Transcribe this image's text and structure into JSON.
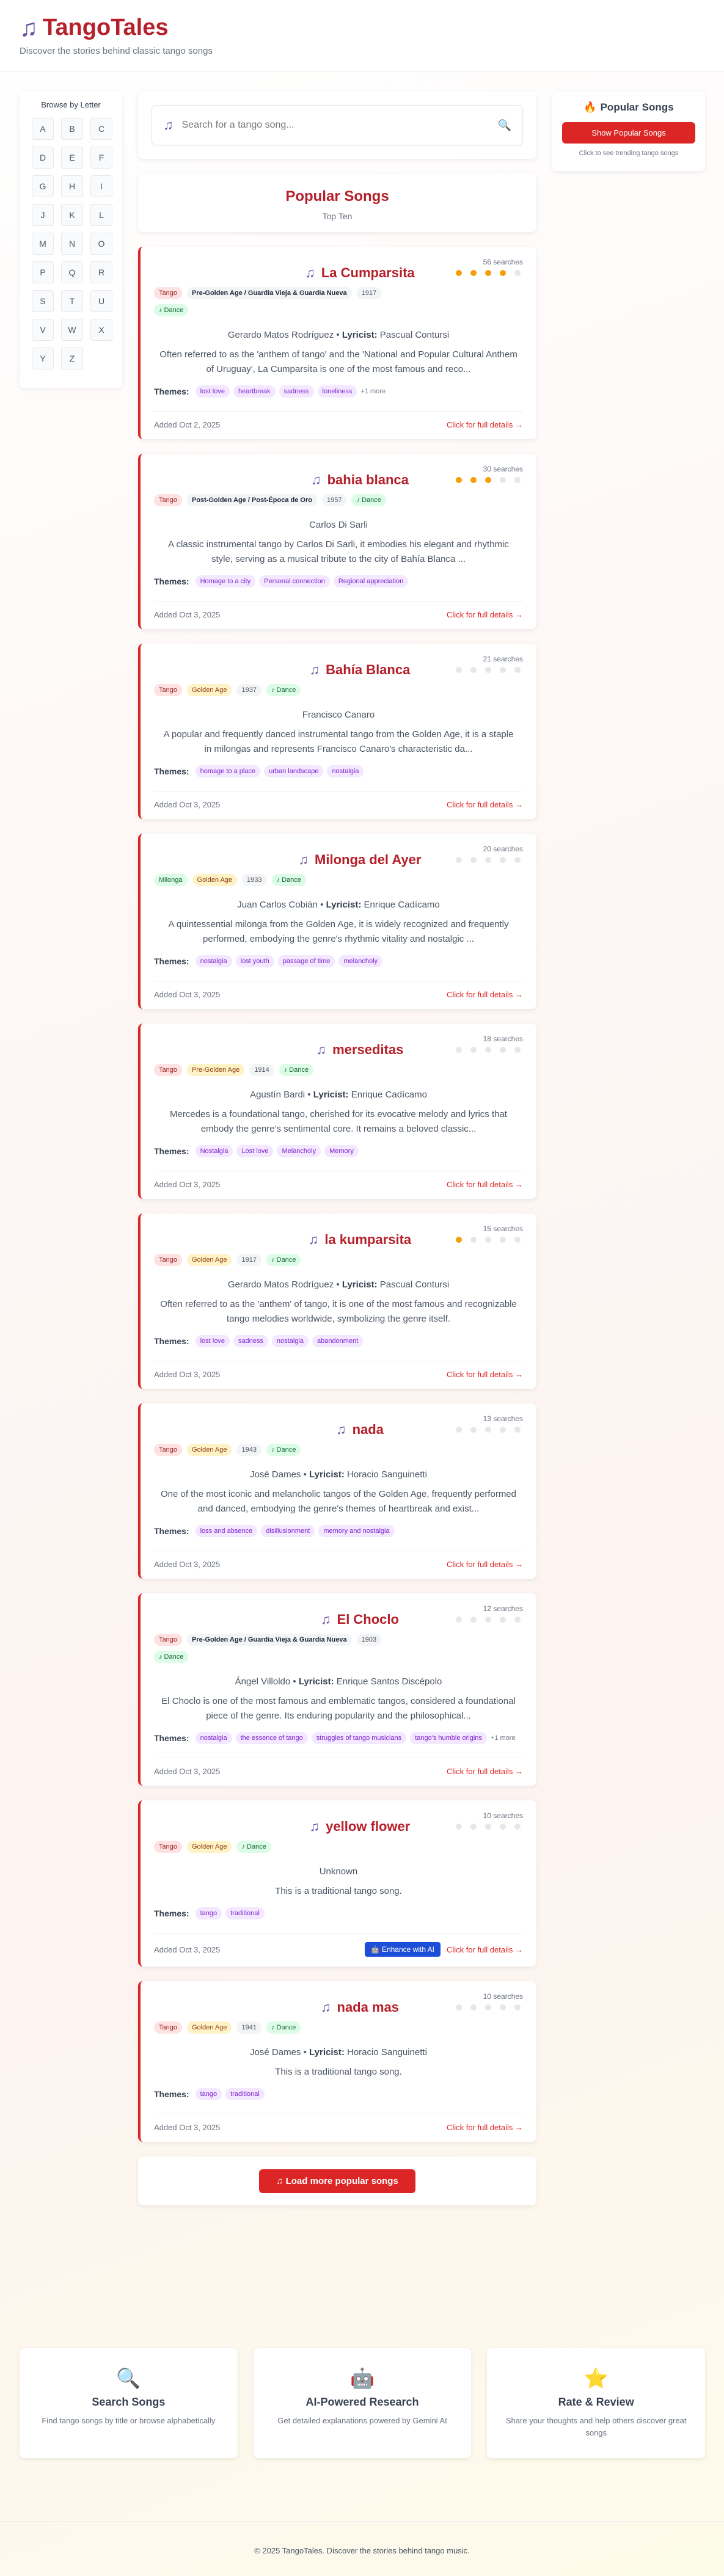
{
  "header": {
    "title": "TangoTales",
    "tagline": "Discover the stories behind classic tango songs"
  },
  "letters": {
    "title": "Browse by Letter",
    "items": [
      "A",
      "B",
      "C",
      "D",
      "E",
      "F",
      "G",
      "H",
      "I",
      "J",
      "K",
      "L",
      "M",
      "N",
      "O",
      "P",
      "Q",
      "R",
      "S",
      "T",
      "U",
      "V",
      "W",
      "X",
      "Y",
      "Z"
    ]
  },
  "search": {
    "placeholder": "Search for a tango song..."
  },
  "popular_panel": {
    "title": "Popular Songs",
    "button": "Show Popular Songs",
    "hint": "Click to see trending tango songs"
  },
  "popular_heading": {
    "title": "Popular Songs",
    "subtitle": "Top Ten"
  },
  "labels": {
    "themes": "Themes:",
    "lyricist": "Lyricist:",
    "details": "Click for full details →",
    "enhance": "Enhance with AI"
  },
  "songs": [
    {
      "title": "La Cumparsita",
      "searches": "56 searches",
      "rating": 4,
      "badges": [
        {
          "text": "Tango",
          "kind": "genre"
        },
        {
          "text": "Pre-Golden Age / Guardia Vieja & Guardia Nueva",
          "kind": "era-long"
        },
        {
          "text": "1917",
          "kind": "year"
        },
        {
          "text": "♪ Dance",
          "kind": "dance"
        }
      ],
      "composer": "Gerardo Matos Rodríguez",
      "lyricist": "Pascual Contursi",
      "description": "Often referred to as the 'anthem of tango' and the 'National and Popular Cultural Anthem of Uruguay', La Cumparsita is one of the most famous and reco...",
      "themes": [
        "lost love",
        "heartbreak",
        "sadness",
        "loneliness"
      ],
      "more": "+1 more",
      "added": "Added Oct 2, 2025"
    },
    {
      "title": "bahia blanca",
      "searches": "30 searches",
      "rating": 3,
      "badges": [
        {
          "text": "Tango",
          "kind": "genre"
        },
        {
          "text": "Post-Golden Age / Post-Época de Oro",
          "kind": "era-long"
        },
        {
          "text": "1957",
          "kind": "year"
        },
        {
          "text": "♪ Dance",
          "kind": "dance"
        }
      ],
      "composer": "Carlos Di Sarli",
      "lyricist": "",
      "description": "A classic instrumental tango by Carlos Di Sarli, it embodies his elegant and rhythmic style, serving as a musical tribute to the city of Bahía Blanca ...",
      "themes": [
        "Homage to a city",
        "Personal connection",
        "Regional appreciation"
      ],
      "more": "",
      "added": "Added Oct 3, 2025"
    },
    {
      "title": "Bahía Blanca",
      "searches": "21 searches",
      "rating": 0,
      "badges": [
        {
          "text": "Tango",
          "kind": "genre"
        },
        {
          "text": "Golden Age",
          "kind": "era"
        },
        {
          "text": "1937",
          "kind": "year"
        },
        {
          "text": "♪ Dance",
          "kind": "dance"
        }
      ],
      "composer": "Francisco Canaro",
      "lyricist": "",
      "description": "A popular and frequently danced instrumental tango from the Golden Age, it is a staple in milongas and represents Francisco Canaro's characteristic da...",
      "themes": [
        "homage to a place",
        "urban landscape",
        "nostalgia"
      ],
      "more": "",
      "added": "Added Oct 3, 2025"
    },
    {
      "title": "Milonga del Ayer",
      "searches": "20 searches",
      "rating": 0,
      "badges": [
        {
          "text": "Milonga",
          "kind": "milonga"
        },
        {
          "text": "Golden Age",
          "kind": "era"
        },
        {
          "text": "1933",
          "kind": "year"
        },
        {
          "text": "♪ Dance",
          "kind": "dance"
        }
      ],
      "composer": "Juan Carlos Cobián",
      "lyricist": "Enrique Cadícamo",
      "description": "A quintessential milonga from the Golden Age, it is widely recognized and frequently performed, embodying the genre's rhythmic vitality and nostalgic ...",
      "themes": [
        "nostalgia",
        "lost youth",
        "passage of time",
        "melancholy"
      ],
      "more": "",
      "added": "Added Oct 3, 2025"
    },
    {
      "title": "merseditas",
      "searches": "18 searches",
      "rating": 0,
      "badges": [
        {
          "text": "Tango",
          "kind": "genre"
        },
        {
          "text": "Pre-Golden Age",
          "kind": "era"
        },
        {
          "text": "1914",
          "kind": "year"
        },
        {
          "text": "♪ Dance",
          "kind": "dance"
        }
      ],
      "composer": "Agustín Bardi",
      "lyricist": "Enrique Cadícamo",
      "description": "Mercedes is a foundational tango, cherished for its evocative melody and lyrics that embody the genre's sentimental core. It remains a beloved classic...",
      "themes": [
        "Nostalgia",
        "Lost love",
        "Melancholy",
        "Memory"
      ],
      "more": "",
      "added": "Added Oct 3, 2025"
    },
    {
      "title": "la kumparsita",
      "searches": "15 searches",
      "rating": 1,
      "badges": [
        {
          "text": "Tango",
          "kind": "genre"
        },
        {
          "text": "Golden Age",
          "kind": "era"
        },
        {
          "text": "1917",
          "kind": "year"
        },
        {
          "text": "♪ Dance",
          "kind": "dance"
        }
      ],
      "composer": "Gerardo Matos Rodríguez",
      "lyricist": "Pascual Contursi",
      "description": "Often referred to as the 'anthem' of tango, it is one of the most famous and recognizable tango melodies worldwide, symbolizing the genre itself.",
      "themes": [
        "lost love",
        "sadness",
        "nostalgia",
        "abandonment"
      ],
      "more": "",
      "added": "Added Oct 3, 2025"
    },
    {
      "title": "nada",
      "searches": "13 searches",
      "rating": 0,
      "badges": [
        {
          "text": "Tango",
          "kind": "genre"
        },
        {
          "text": "Golden Age",
          "kind": "era"
        },
        {
          "text": "1943",
          "kind": "year"
        },
        {
          "text": "♪ Dance",
          "kind": "dance"
        }
      ],
      "composer": "José Dames",
      "lyricist": "Horacio Sanguinetti",
      "description": "One of the most iconic and melancholic tangos of the Golden Age, frequently performed and danced, embodying the genre's themes of heartbreak and exist...",
      "themes": [
        "loss and absence",
        "disillusionment",
        "memory and nostalgia"
      ],
      "more": "",
      "added": "Added Oct 3, 2025"
    },
    {
      "title": "El Choclo",
      "searches": "12 searches",
      "rating": 0,
      "badges": [
        {
          "text": "Tango",
          "kind": "genre"
        },
        {
          "text": "Pre-Golden Age / Guardia Vieja & Guardia Nueva",
          "kind": "era-long"
        },
        {
          "text": "1903",
          "kind": "year"
        },
        {
          "text": "♪ Dance",
          "kind": "dance"
        }
      ],
      "composer": "Ángel Villoldo",
      "lyricist": "Enrique Santos Discépolo",
      "description": "El Choclo is one of the most famous and emblematic tangos, considered a foundational piece of the genre. Its enduring popularity and the philosophical...",
      "themes": [
        "nostalgia",
        "the essence of tango",
        "struggles of tango musicians",
        "tango's humble origins"
      ],
      "more": "+1 more",
      "added": "Added Oct 3, 2025"
    },
    {
      "title": "yellow flower",
      "searches": "10 searches",
      "rating": 0,
      "badges": [
        {
          "text": "Tango",
          "kind": "genre"
        },
        {
          "text": "Golden Age",
          "kind": "era"
        },
        {
          "text": "♪ Dance",
          "kind": "dance"
        }
      ],
      "composer": "Unknown",
      "lyricist": "",
      "description": "This is a traditional tango song.",
      "themes": [
        "tango",
        "traditional"
      ],
      "more": "",
      "added": "Added Oct 3, 2025",
      "enhance": true
    },
    {
      "title": "nada mas",
      "searches": "10 searches",
      "rating": 0,
      "badges": [
        {
          "text": "Tango",
          "kind": "genre"
        },
        {
          "text": "Golden Age",
          "kind": "era"
        },
        {
          "text": "1941",
          "kind": "year"
        },
        {
          "text": "♪ Dance",
          "kind": "dance"
        }
      ],
      "composer": "José Dames",
      "lyricist": "Horacio Sanguinetti",
      "description": "This is a traditional tango song.",
      "themes": [
        "tango",
        "traditional"
      ],
      "more": "",
      "added": "Added Oct 3, 2025"
    }
  ],
  "load_more": "Load more popular songs",
  "features": [
    {
      "icon": "🔍",
      "icon_name": "magnifier-icon",
      "title": "Search Songs",
      "desc": "Find tango songs by title or browse alphabetically"
    },
    {
      "icon": "🤖",
      "icon_name": "robot-icon",
      "title": "AI-Powered Research",
      "desc": "Get detailed explanations powered by Gemini AI"
    },
    {
      "icon": "⭐",
      "icon_name": "star-icon",
      "title": "Rate & Review",
      "desc": "Share your thoughts and help others discover great songs"
    }
  ],
  "footer": "© 2025 TangoTales. Discover the stories behind tango music.",
  "colors": {
    "brand": "#b5202a",
    "accent": "#dc2626",
    "note": "#6b4fa3",
    "star": "#f59e0b"
  }
}
